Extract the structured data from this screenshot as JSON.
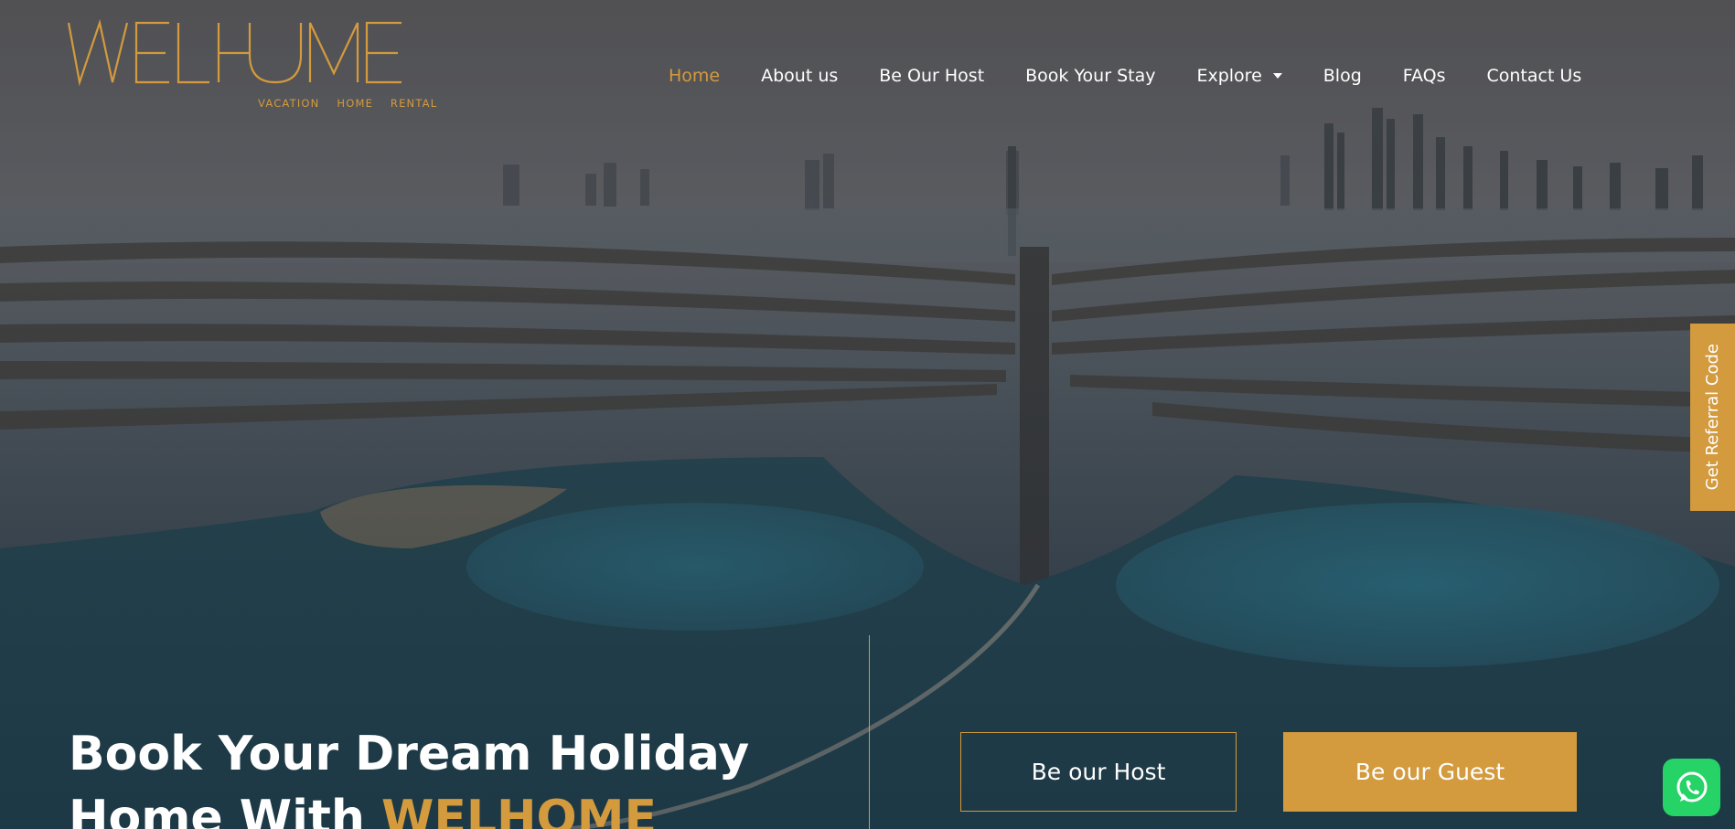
{
  "brand": {
    "tagline_words": [
      "VACATION",
      "HOME",
      "RENTAL"
    ],
    "logo_text": "WELHOME",
    "accent_color": "#d39a3e"
  },
  "nav": {
    "items": [
      {
        "label": "Home",
        "active": true
      },
      {
        "label": "About us"
      },
      {
        "label": "Be Our Host"
      },
      {
        "label": "Book Your Stay"
      },
      {
        "label": "Explore",
        "has_dropdown": true
      },
      {
        "label": "Blog"
      },
      {
        "label": "FAQs"
      },
      {
        "label": "Contact Us"
      }
    ]
  },
  "referral": {
    "label": "Get Referral Code"
  },
  "hero": {
    "headline_line1": "Book Your Dream Holiday",
    "headline_line2_prefix": "Home With ",
    "headline_line2_brand": "WELHOME",
    "host_button": "Be our Host",
    "guest_button": "Be our Guest"
  },
  "whatsapp": {
    "icon": "whatsapp-icon",
    "color": "#25d366"
  }
}
